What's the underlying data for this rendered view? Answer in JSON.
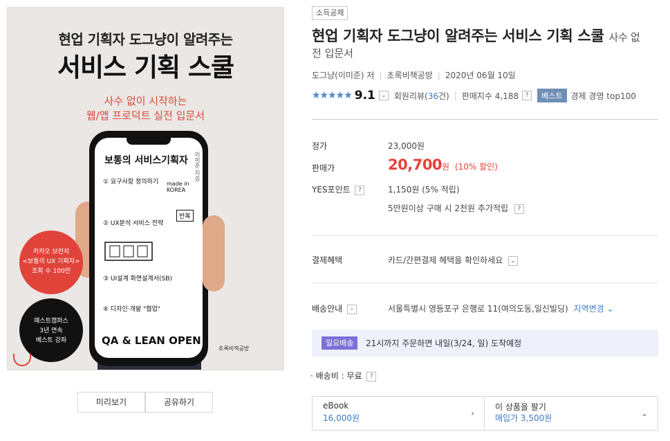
{
  "cover": {
    "top_line": "현업 기획자 도그냥이 알려주는",
    "title": "서비스 기획 스쿨",
    "sub1": "사수 없이 시작하는",
    "sub2": "웹/앱 프로덕트 실전 입문서",
    "screen_title": "보통의 서비스기획자",
    "screen_author": "이미준 지음",
    "screen_step1": "① 요구사항 정의하기",
    "screen_made": "made in KOREA",
    "screen_step2": "② UX분석 서비스 전략",
    "screen_repeat": "반복",
    "screen_step3": "③ UI설계 화면설계서(SB)",
    "screen_step4": "④ 디자인·개발 \"협업\"",
    "screen_bottom": "QA & LEAN OPEN",
    "badge_red": [
      "카카오 브런치",
      "<보통의 UX 기획자>",
      "조회 수 100만"
    ],
    "badge_black": [
      "패스트캠퍼스",
      "3년 연속",
      "베스트 강좌"
    ],
    "publisher_logo": "초록비책공방"
  },
  "buttons": {
    "preview": "미리보기",
    "share": "공유하기"
  },
  "product": {
    "tag": "소득공제",
    "title": "현업 기획자 도그냥이 알려주는 서비스 기획 스쿨",
    "subtitle_part1": "사수 없",
    "subtitle_part2": "전 입문서",
    "author": "도그냥(이미준) 저",
    "publisher": "초록비책공방",
    "date": "2020년 06월 10일",
    "stars": "★★★★★",
    "score": "9.1",
    "review_label": "회원리뷰(",
    "review_count": "36",
    "review_suffix": "건)",
    "sales_index": "판매지수 4,188",
    "best_badge": "베스트",
    "best_rank": "경제 경영 top100"
  },
  "pricing": {
    "list_label": "정가",
    "list_price": "23,000원",
    "sale_label": "판매가",
    "sale_price": "20,700",
    "sale_won": "원",
    "discount": "(10% 할인)",
    "point_label": "YES포인트",
    "point_value": "1,150원 (5% 적립)",
    "point_extra": "5만원이상 구매 시 2천원 추가적립"
  },
  "benefit": {
    "label": "결제혜택",
    "value": "카드/간편결제 혜택을 확인하세요"
  },
  "shipping": {
    "label": "배송안내",
    "address": "서울특별시 영등포구 은행로 11(여의도동,일신빌딩)",
    "change_region": "지역변경",
    "badge": "일요배송",
    "notice": "21시까지 주문하면 내일(3/24, 일) 도착예정",
    "fee": "· 배송비 : 무료"
  },
  "options": {
    "ebook_label": "eBook",
    "ebook_price": "16,000원",
    "sell_label": "이 상품을 팔기",
    "sell_price": "매입가 3,500원"
  }
}
